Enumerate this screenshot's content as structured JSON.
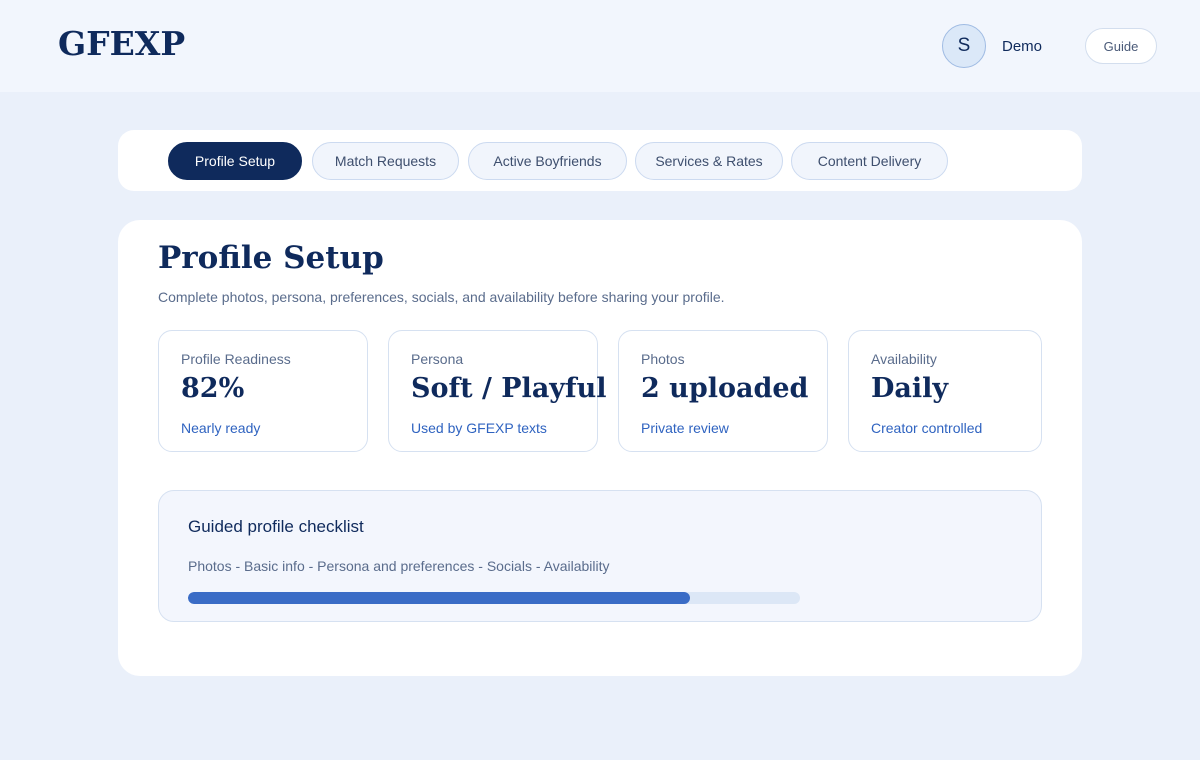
{
  "header": {
    "logo": "GFEXP",
    "avatar_initial": "S",
    "username": "Demo",
    "guide_label": "Guide"
  },
  "tabs": [
    {
      "label": "Profile Setup",
      "active": true
    },
    {
      "label": "Match Requests",
      "active": false
    },
    {
      "label": "Active Boyfriends",
      "active": false
    },
    {
      "label": "Services & Rates",
      "active": false
    },
    {
      "label": "Content Delivery",
      "active": false
    }
  ],
  "main": {
    "title": "Profile Setup",
    "subtitle": "Complete photos, persona, preferences, socials, and availability before sharing your profile.",
    "stats": [
      {
        "label": "Profile Readiness",
        "value": "82%",
        "note": "Nearly ready"
      },
      {
        "label": "Persona",
        "value": "Soft / Playful",
        "note": "Used by GFEXP texts"
      },
      {
        "label": "Photos",
        "value": "2 uploaded",
        "note": "Private review"
      },
      {
        "label": "Availability",
        "value": "Daily",
        "note": "Creator controlled"
      }
    ],
    "checklist": {
      "title": "Guided profile checklist",
      "steps": "Photos - Basic info - Persona and preferences - Socials - Availability",
      "progress": 0.82
    }
  },
  "colors": {
    "primary": "#0f2a5c",
    "accent": "#3a6cc6",
    "background": "#eaf0fa"
  }
}
